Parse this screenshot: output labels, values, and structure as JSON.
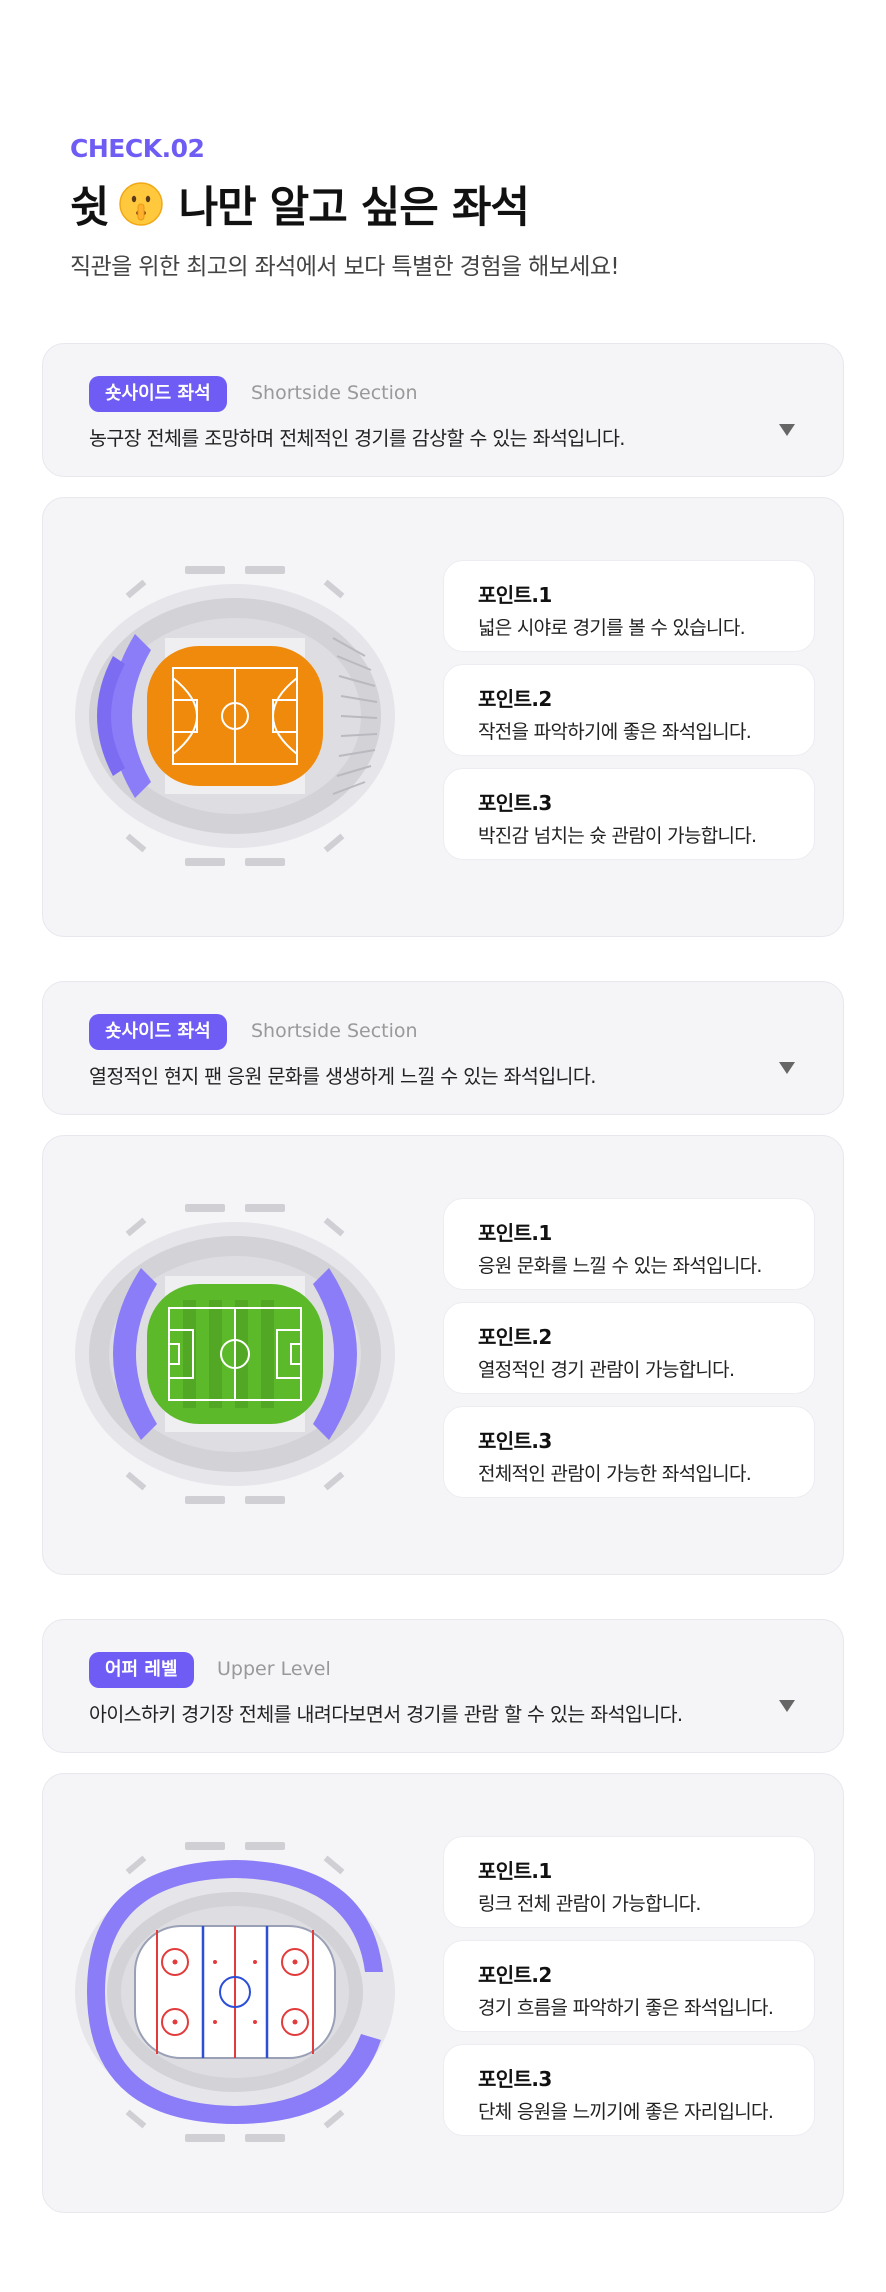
{
  "header": {
    "check": "CHECK.02",
    "title_before": "쉿",
    "title_icon": "shushing-face-emoji",
    "title_after": "나만 알고 싶은 좌석",
    "subtitle": "직관을 위한 최고의 좌석에서 보다 특별한 경험을 해보세요!"
  },
  "colors": {
    "accent": "#6e5cf5",
    "basketball_court": "#f08a0c",
    "soccer_field": "#5cba2a",
    "ice_rink": "#ffffff",
    "section_highlight": "#8b7cf7"
  },
  "sections": [
    {
      "badge": "숏사이드 좌석",
      "en": "Shortside Section",
      "desc": "농구장 전체를 조망하며 전체적인 경기를 감상할 수 있는 좌석입니다.",
      "expand_icon": "triangle-down-icon",
      "venue": "basketball",
      "points": [
        {
          "title": "포인트.1",
          "desc": "넓은 시야로 경기를 볼 수 있습니다."
        },
        {
          "title": "포인트.2",
          "desc": "작전을 파악하기에 좋은 좌석입니다."
        },
        {
          "title": "포인트.3",
          "desc": "박진감 넘치는 슛 관람이 가능합니다."
        }
      ]
    },
    {
      "badge": "숏사이드 좌석",
      "en": "Shortside Section",
      "desc": "열정적인 현지 팬 응원 문화를 생생하게 느낄 수 있는 좌석입니다.",
      "expand_icon": "triangle-down-icon",
      "venue": "soccer",
      "points": [
        {
          "title": "포인트.1",
          "desc": "응원 문화를 느낄 수 있는 좌석입니다."
        },
        {
          "title": "포인트.2",
          "desc": "열정적인 경기 관람이 가능합니다."
        },
        {
          "title": "포인트.3",
          "desc": "전체적인 관람이 가능한 좌석입니다."
        }
      ]
    },
    {
      "badge": "어퍼 레벨",
      "en": "Upper Level",
      "desc": "아이스하키 경기장 전체를 내려다보면서 경기를 관람 할 수 있는 좌석입니다.",
      "expand_icon": "triangle-down-icon",
      "venue": "hockey",
      "points": [
        {
          "title": "포인트.1",
          "desc": "링크 전체 관람이 가능합니다."
        },
        {
          "title": "포인트.2",
          "desc": "경기 흐름을 파악하기 좋은 좌석입니다."
        },
        {
          "title": "포인트.3",
          "desc": "단체 응원을 느끼기에 좋은 자리입니다."
        }
      ]
    }
  ]
}
